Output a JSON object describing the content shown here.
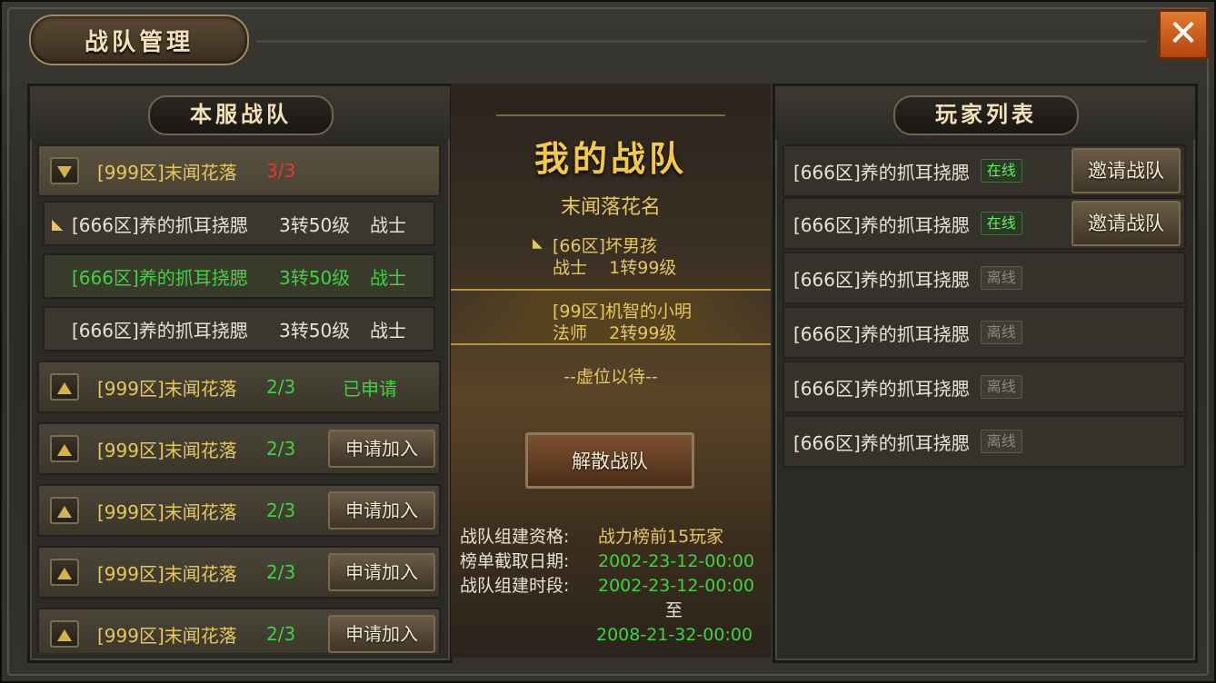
{
  "window": {
    "title": "战队管理",
    "close_glyph": "✕"
  },
  "left_panel": {
    "header": "本服战队",
    "expanded_team": {
      "name": "[999区]末闻花落",
      "count": "3/3"
    },
    "members": [
      {
        "name": "[666区]养的抓耳挠腮",
        "level": "3转50级",
        "job": "战士",
        "marker": true,
        "highlight": false
      },
      {
        "name": "[666区]养的抓耳挠腮",
        "level": "3转50级",
        "job": "战士",
        "marker": false,
        "highlight": true
      },
      {
        "name": "[666区]养的抓耳挠腮",
        "level": "3转50级",
        "job": "战士",
        "marker": false,
        "highlight": false
      }
    ],
    "applied_team": {
      "name": "[999区]末闻花落",
      "count": "2/3",
      "status": "已申请"
    },
    "teams": [
      {
        "name": "[999区]末闻花落",
        "count": "2/3",
        "button": "申请加入"
      },
      {
        "name": "[999区]末闻花落",
        "count": "2/3",
        "button": "申请加入"
      },
      {
        "name": "[999区]末闻花落",
        "count": "2/3",
        "button": "申请加入"
      },
      {
        "name": "[999区]末闻花落",
        "count": "2/3",
        "button": "申请加入"
      }
    ]
  },
  "center": {
    "title": "我的战队",
    "team_name": "末闻落花名",
    "slots": [
      {
        "line1": "[66区]坏男孩",
        "line2": "战士    1转99级",
        "marker": true,
        "selected": false
      },
      {
        "line1": "[99区]机智的小明",
        "line2": "法师    2转99级",
        "marker": false,
        "selected": true
      }
    ],
    "empty_slot": "--虚位以待--",
    "disband_button": "解散战队",
    "info": {
      "qualification_label": "战队组建资格:",
      "qualification_value": "战力榜前15玩家",
      "deadline_label": "榜单截取日期:",
      "deadline_value": "2002-23-12-00:00",
      "period_label": "战队组建时段:",
      "period_start": "2002-23-12-00:00",
      "period_to": "至",
      "period_end": "2008-21-32-00:00"
    }
  },
  "right_panel": {
    "header": "玩家列表",
    "players": [
      {
        "name": "[666区]养的抓耳挠腮",
        "status": "在线",
        "online": true,
        "button": "邀请战队"
      },
      {
        "name": "[666区]养的抓耳挠腮",
        "status": "在线",
        "online": true,
        "button": "邀请战队"
      },
      {
        "name": "[666区]养的抓耳挠腮",
        "status": "离线",
        "online": false
      },
      {
        "name": "[666区]养的抓耳挠腮",
        "status": "离线",
        "online": false
      },
      {
        "name": "[666区]养的抓耳挠腮",
        "status": "离线",
        "online": false
      },
      {
        "name": "[666区]养的抓耳挠腮",
        "status": "离线",
        "online": false
      }
    ]
  }
}
